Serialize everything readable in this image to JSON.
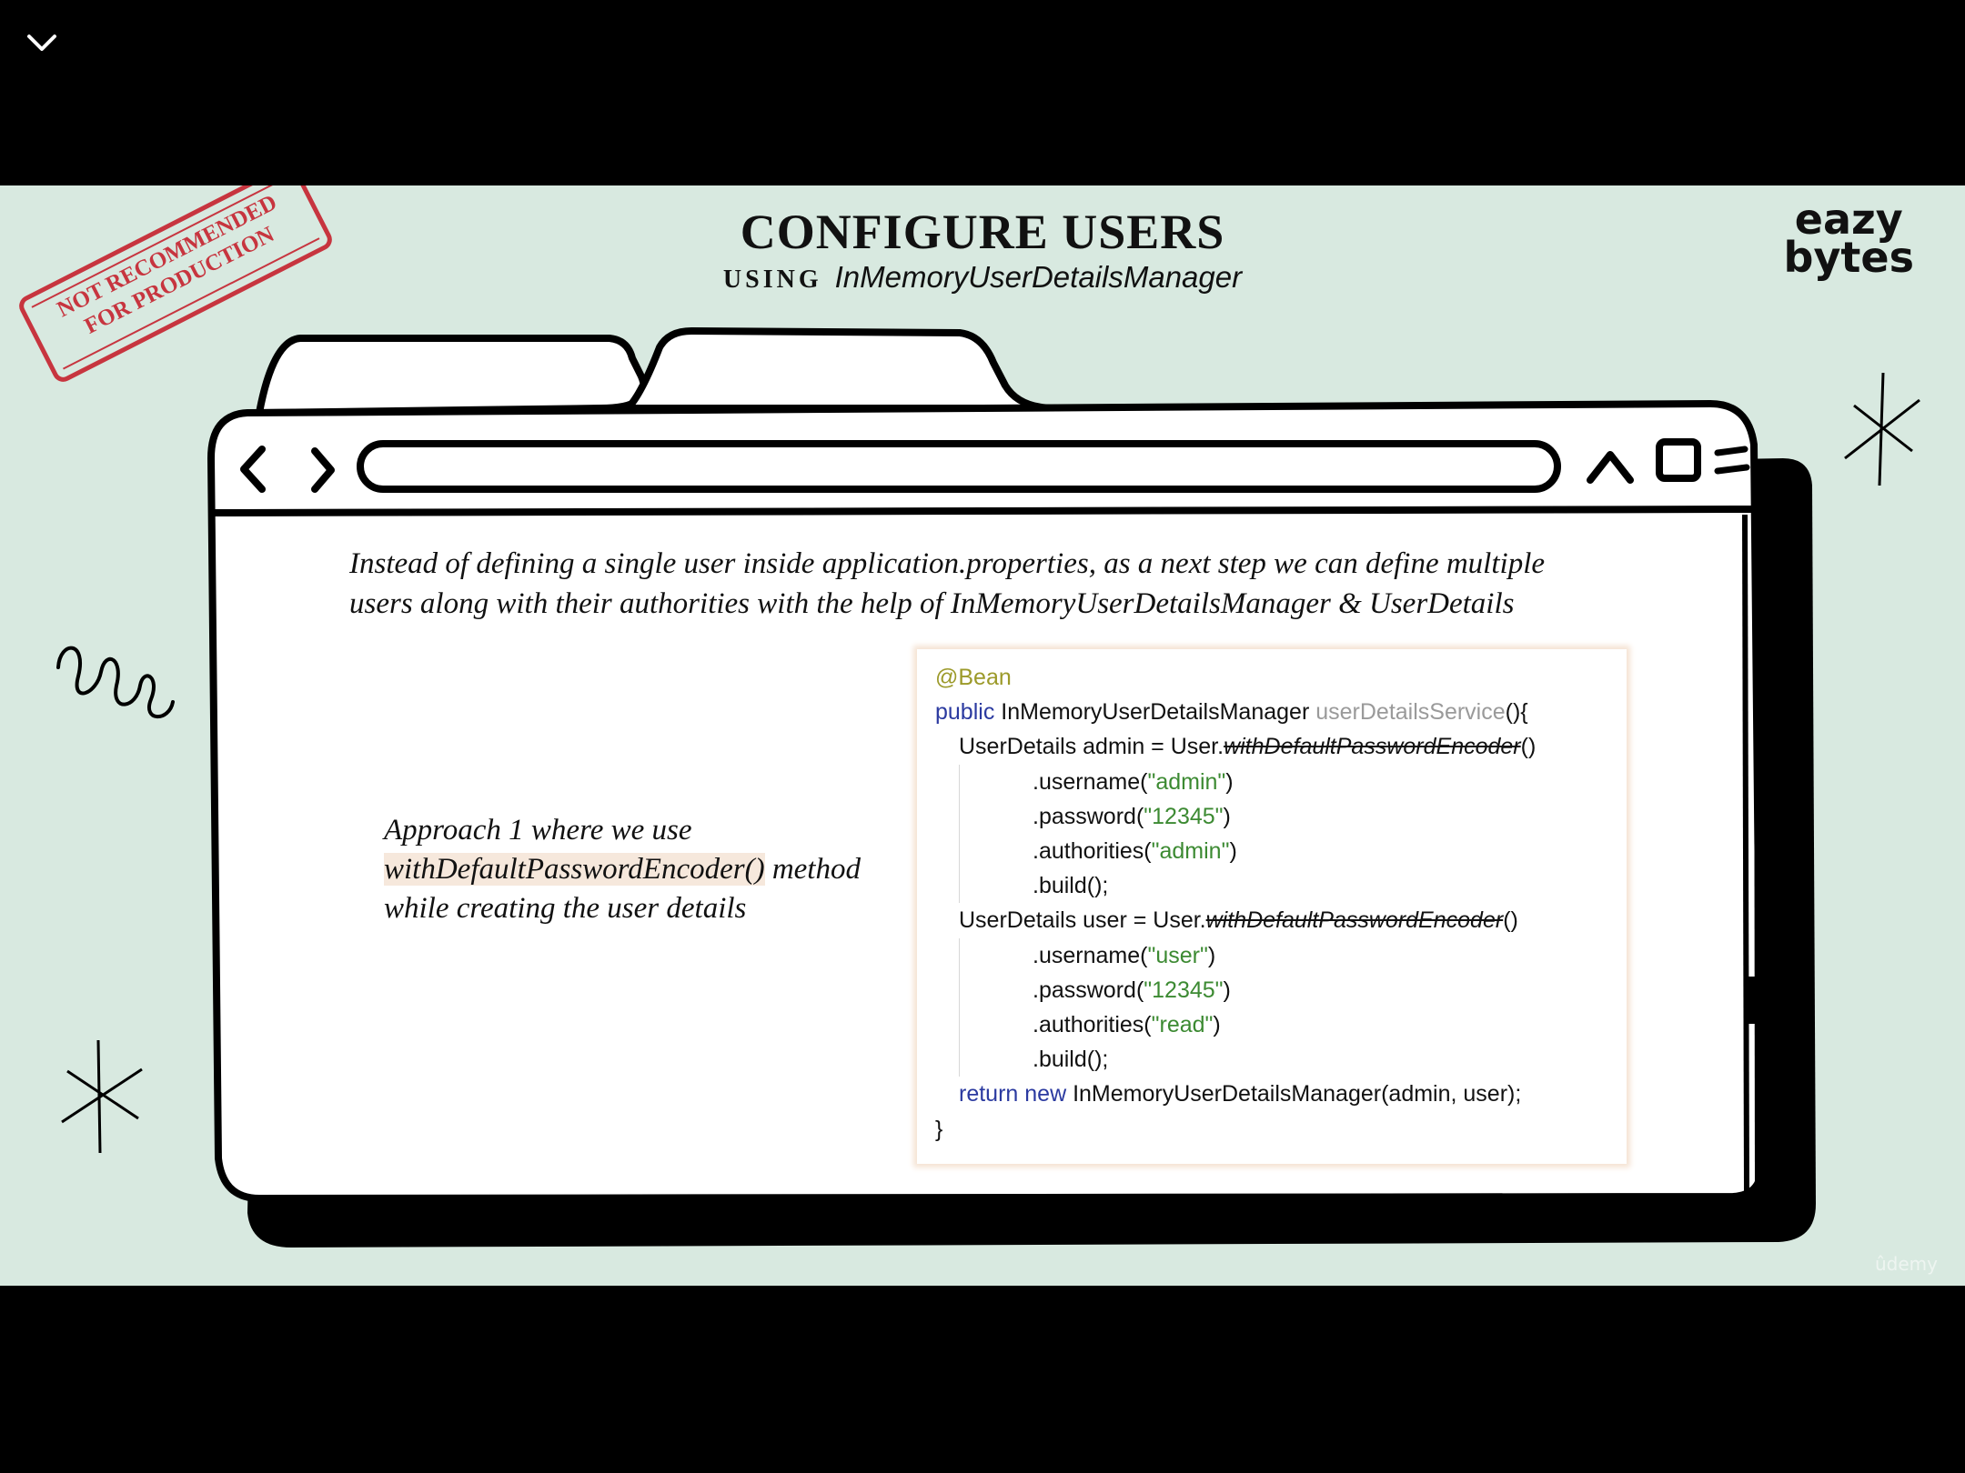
{
  "player": {
    "collapse_icon": "chevron-down-icon"
  },
  "header": {
    "title": "CONFIGURE USERS",
    "using": "USING",
    "class_name": "InMemoryUserDetailsManager"
  },
  "logo": {
    "line1": "eazy",
    "line2": "bytes"
  },
  "stamp": {
    "line1": "NOT RECOMMENDED",
    "line2": "FOR PRODUCTION"
  },
  "browser": {
    "back_icon": "chevron-left-icon",
    "forward_icon": "chevron-right-icon",
    "up_icon": "caret-up-icon",
    "max_icon": "square-icon",
    "menu_icon": "menu-icon"
  },
  "description": {
    "line1": "Instead of  defining a single user inside application.properties, as a next step we can define multiple",
    "line2": "users along with their authorities with the help of  InMemoryUserDetailsManager & UserDetails"
  },
  "approach": {
    "line1": "Approach 1 where we use",
    "highlight": "withDefaultPasswordEncoder()",
    "after_highlight": " method",
    "line3": "while creating the user details"
  },
  "code": {
    "annotation": "@Bean",
    "kw_public": "public",
    "return_type": " InMemoryUserDetailsManager ",
    "method_name": "userDetailsService",
    "sig_end": "(){",
    "admin_decl": "UserDetails admin = User.",
    "encoder": "withDefaultPasswordEncoder",
    "call_end": "()",
    "username_open": ".username(",
    "admin_user": "\"admin\"",
    "close_paren": ")",
    "password_open": ".password(",
    "pwd": "\"12345\"",
    "authorities_open": ".authorities(",
    "admin_auth": "\"admin\"",
    "build": ".build();",
    "user_decl": "UserDetails user = User.",
    "user_user": "\"user\"",
    "read_auth": "\"read\"",
    "kw_return": "return",
    "kw_new": "new",
    "return_rest": " InMemoryUserDetailsManager(admin, user);",
    "close_brace": "}"
  },
  "watermark": "ûdemy"
}
